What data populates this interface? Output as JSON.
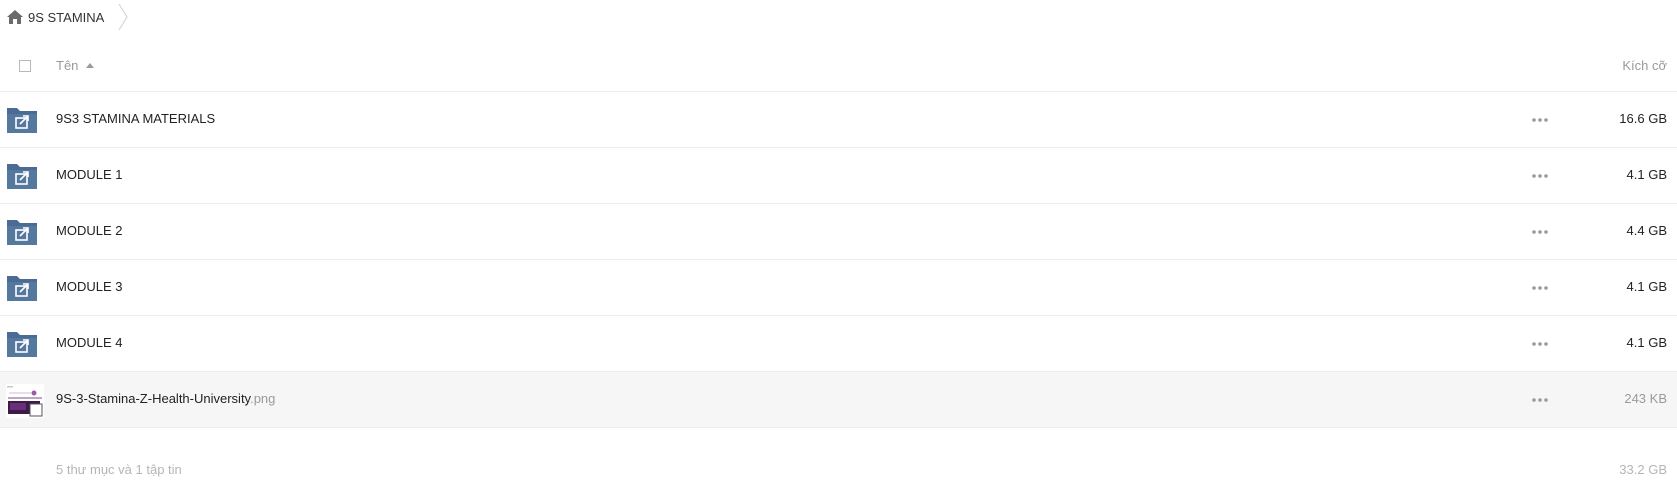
{
  "breadcrumb": {
    "home_label": "9S STAMINA"
  },
  "header": {
    "name_label": "Tên",
    "size_label": "Kích cỡ"
  },
  "rows": [
    {
      "name": "9S3 STAMINA MATERIALS",
      "ext": "",
      "size": "16.6 GB",
      "type": "shared-folder-icon"
    },
    {
      "name": "MODULE 1",
      "ext": "",
      "size": "4.1 GB",
      "type": "shared-folder-icon"
    },
    {
      "name": "MODULE 2",
      "ext": "",
      "size": "4.4 GB",
      "type": "shared-folder-icon"
    },
    {
      "name": "MODULE 3",
      "ext": "",
      "size": "4.1 GB",
      "type": "shared-folder-icon"
    },
    {
      "name": "MODULE 4",
      "ext": "",
      "size": "4.1 GB",
      "type": "shared-folder-icon"
    },
    {
      "name": "9S-3-Stamina-Z-Health-University",
      "ext": ".png",
      "size": "243 KB",
      "type": "image-thumbnail"
    }
  ],
  "footer": {
    "summary": "5 thư mục và 1 tập tin",
    "total": "33.2 GB"
  },
  "colors": {
    "folder": "#4a6b96",
    "thumbnail_purple": "#5a2d6a"
  }
}
